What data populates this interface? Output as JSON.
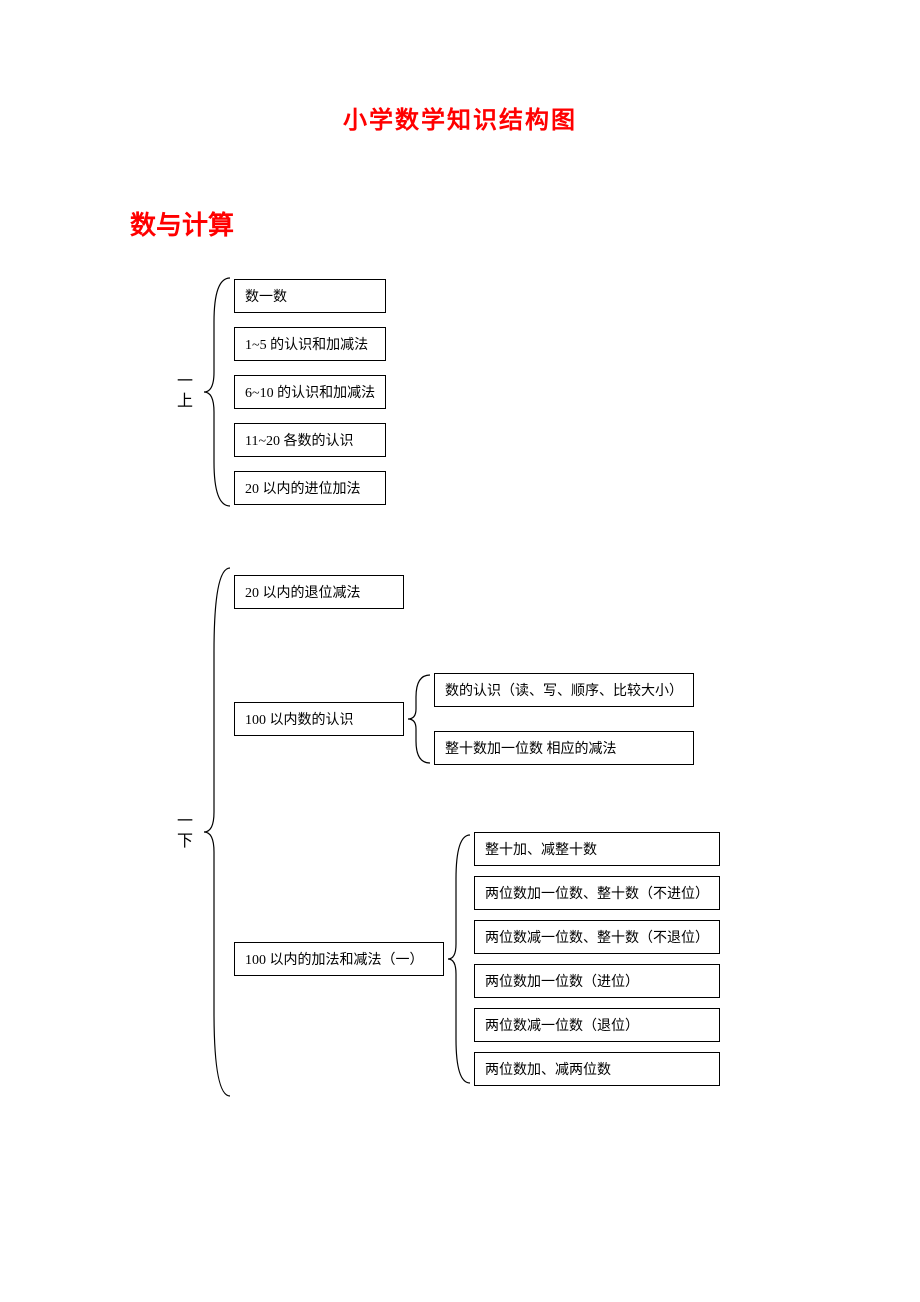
{
  "title": "小学数学知识结构图",
  "section": "数与计算",
  "groups": [
    {
      "label": "一上",
      "items": [
        "数一数",
        "1~5 的认识和加减法",
        "6~10 的认识和加减法",
        "11~20 各数的认识",
        "20 以内的进位加法"
      ]
    },
    {
      "label": "一下",
      "items": [
        {
          "text": "20 以内的退位减法"
        },
        {
          "text": "100 以内数的认识",
          "children": [
            "数的认识（读、写、顺序、比较大小）",
            "整十数加一位数 相应的减法"
          ]
        },
        {
          "text": "100 以内的加法和减法（一）",
          "children": [
            "整十加、减整十数",
            "两位数加一位数、整十数（不进位）",
            "两位数减一位数、整十数（不退位）",
            "两位数加一位数（进位）",
            "两位数减一位数（退位）",
            "两位数加、减两位数"
          ]
        }
      ]
    }
  ]
}
